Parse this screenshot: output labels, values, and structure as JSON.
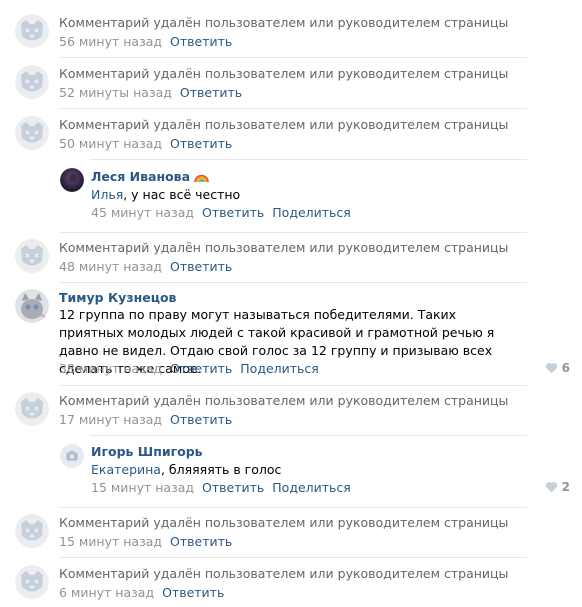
{
  "deleted_text": "Комментарий удалён пользователем или руководителем страницы",
  "actions": {
    "reply": "Ответить",
    "share": "Поделиться"
  },
  "comments": [
    {
      "type": "deleted",
      "time": "56 минут назад"
    },
    {
      "type": "deleted",
      "time": "52 минуты назад"
    },
    {
      "type": "deleted",
      "time": "50 минут назад"
    },
    {
      "type": "reply",
      "author": "Леся Иванова",
      "reply_to": "Илья",
      "text": ", у нас всё честно",
      "time": "45 минут назад"
    },
    {
      "type": "deleted",
      "time": "48 минут назад"
    },
    {
      "type": "comment",
      "author": "Тимур Кузнецов",
      "text": "12 группа по праву могут называться победителями. Таких приятных молодых людей с такой красивой и грамотной речью я давно не видел. Отдаю свой голос за 12 группу и призываю всех сделать то же самое.",
      "time": "38 минут назад",
      "likes": "6"
    },
    {
      "type": "deleted",
      "time": "17 минут назад"
    },
    {
      "type": "reply",
      "author": "Игорь Шпигорь",
      "reply_to": "Екатерина",
      "text": ", бляяяять в голос",
      "time": "15 минут назад",
      "likes": "2"
    },
    {
      "type": "deleted",
      "time": "15 минут назад"
    },
    {
      "type": "deleted",
      "time": "6 минут назад"
    }
  ],
  "colors": {
    "link": "#2a5885",
    "meta": "#939393",
    "deleted": "#656565",
    "divider": "#e7e8ec",
    "placeholder_avatar": "#c5d0db"
  }
}
